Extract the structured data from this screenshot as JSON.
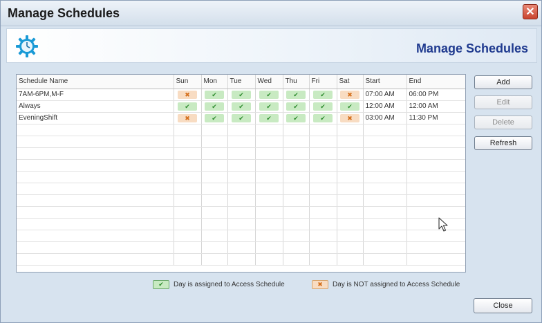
{
  "window": {
    "title": "Manage Schedules",
    "close_symbol": "✕"
  },
  "header": {
    "title": "Manage Schedules",
    "icon": "clock-icon"
  },
  "table": {
    "columns": [
      "Schedule Name",
      "Sun",
      "Mon",
      "Tue",
      "Wed",
      "Thu",
      "Fri",
      "Sat",
      "Start",
      "End"
    ],
    "rows": [
      {
        "name": "7AM-6PM,M-F",
        "days": [
          false,
          true,
          true,
          true,
          true,
          true,
          false
        ],
        "start": "07:00 AM",
        "end": "06:00 PM"
      },
      {
        "name": "Always",
        "days": [
          true,
          true,
          true,
          true,
          true,
          true,
          true
        ],
        "start": "12:00 AM",
        "end": "12:00 AM"
      },
      {
        "name": "EveningShift",
        "days": [
          false,
          true,
          true,
          true,
          true,
          true,
          false
        ],
        "start": "03:00 AM",
        "end": "11:30 PM"
      }
    ],
    "yes_symbol": "✔",
    "no_symbol": "✖"
  },
  "buttons": {
    "add": "Add",
    "edit": "Edit",
    "delete": "Delete",
    "refresh": "Refresh",
    "close": "Close"
  },
  "legend": {
    "assigned": "Day is assigned to Access Schedule",
    "not_assigned": "Day is NOT assigned to Access Schedule"
  },
  "colors": {
    "assigned": "#c8eac2",
    "not_assigned": "#f8dcc2",
    "header_title": "#1f3a8f",
    "clock": "#1a9ad6"
  }
}
